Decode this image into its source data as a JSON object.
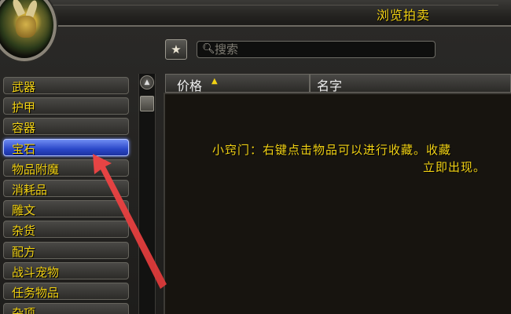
{
  "window": {
    "title": "浏览拍卖"
  },
  "search": {
    "placeholder": "搜索",
    "value": ""
  },
  "categories": [
    {
      "label": "武器"
    },
    {
      "label": "护甲"
    },
    {
      "label": "容器"
    },
    {
      "label": "宝石",
      "active": true
    },
    {
      "label": "物品附魔"
    },
    {
      "label": "消耗品"
    },
    {
      "label": "雕文"
    },
    {
      "label": "杂货"
    },
    {
      "label": "配方"
    },
    {
      "label": "战斗宠物"
    },
    {
      "label": "任务物品"
    },
    {
      "label": "杂项"
    }
  ],
  "columns": {
    "price": "价格",
    "name": "名字"
  },
  "tip": {
    "line1": "小窍门：右键点击物品可以进行收藏。收藏",
    "line2": "立即出现。"
  },
  "icons": {
    "favorite": "star-icon",
    "search": "magnifier-icon",
    "sort": "sort-arrow-icon",
    "scroll_up": "scroll-up-icon",
    "annotation": "red-arrow-icon"
  },
  "colors": {
    "text_gold": "#f2d214",
    "selected": "#2a47c8",
    "annotation_arrow": "#e43a3a"
  }
}
